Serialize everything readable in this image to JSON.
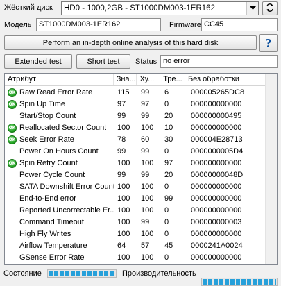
{
  "header": {
    "drive_label": "Жёсткий диск",
    "drive_value": "HD0 - 1000,2GB - ST1000DM003-1ER162",
    "refresh_icon": "refresh-icon"
  },
  "info": {
    "model_label": "Модель",
    "model_value": "ST1000DM003-1ER162",
    "firmware_label": "Firmware",
    "firmware_value": "CC45"
  },
  "actions": {
    "online_analysis_label": "Perform an in-depth online analysis of this hard disk",
    "help_label": "?",
    "extended_test_label": "Extended test",
    "short_test_label": "Short test",
    "status_label": "Status",
    "status_value": "no error"
  },
  "table": {
    "columns": [
      "Атрибут",
      "Зна...",
      "Ху...",
      "Тре...",
      "Без обработки"
    ],
    "rows": [
      {
        "icon": "ok",
        "name": "Raw Read Error Rate",
        "value": "115",
        "worst": "99",
        "threshold": "6",
        "raw": "000005265DC8"
      },
      {
        "icon": "ok",
        "name": "Spin Up Time",
        "value": "97",
        "worst": "97",
        "threshold": "0",
        "raw": "000000000000"
      },
      {
        "icon": "",
        "name": "Start/Stop Count",
        "value": "99",
        "worst": "99",
        "threshold": "20",
        "raw": "000000000495"
      },
      {
        "icon": "ok",
        "name": "Reallocated Sector Count",
        "value": "100",
        "worst": "100",
        "threshold": "10",
        "raw": "000000000000"
      },
      {
        "icon": "ok",
        "name": "Seek Error Rate",
        "value": "78",
        "worst": "60",
        "threshold": "30",
        "raw": "000004E28713"
      },
      {
        "icon": "",
        "name": "Power On Hours Count",
        "value": "99",
        "worst": "99",
        "threshold": "0",
        "raw": "0000000005D4"
      },
      {
        "icon": "ok",
        "name": "Spin Retry Count",
        "value": "100",
        "worst": "100",
        "threshold": "97",
        "raw": "000000000000"
      },
      {
        "icon": "",
        "name": "Power Cycle Count",
        "value": "99",
        "worst": "99",
        "threshold": "20",
        "raw": "00000000048D"
      },
      {
        "icon": "",
        "name": "SATA Downshift Error Count",
        "value": "100",
        "worst": "100",
        "threshold": "0",
        "raw": "000000000000"
      },
      {
        "icon": "",
        "name": "End-to-End error",
        "value": "100",
        "worst": "100",
        "threshold": "99",
        "raw": "000000000000"
      },
      {
        "icon": "",
        "name": "Reported Uncorrectable Er...",
        "value": "100",
        "worst": "100",
        "threshold": "0",
        "raw": "000000000000"
      },
      {
        "icon": "",
        "name": "Command Timeout",
        "value": "100",
        "worst": "99",
        "threshold": "0",
        "raw": "000000000003"
      },
      {
        "icon": "",
        "name": "High Fly Writes",
        "value": "100",
        "worst": "100",
        "threshold": "0",
        "raw": "000000000000"
      },
      {
        "icon": "",
        "name": "Airflow Temperature",
        "value": "64",
        "worst": "57",
        "threshold": "45",
        "raw": "0000241A0024"
      },
      {
        "icon": "",
        "name": "GSense Error Rate",
        "value": "100",
        "worst": "100",
        "threshold": "0",
        "raw": "000000000000"
      }
    ]
  },
  "footer": {
    "state_label": "Состояние",
    "state_level": 1.0,
    "performance_label": "Производительность",
    "performance_level": 1.0,
    "bar_color": "#26a0da"
  }
}
